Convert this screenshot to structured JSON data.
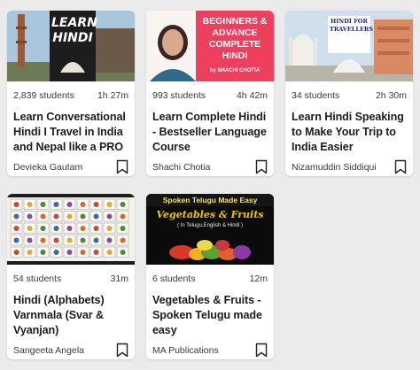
{
  "courses": [
    {
      "students": "2,839 students",
      "duration": "1h 27m",
      "title": "Learn Conversational Hindi I Travel in India and Nepal like a PRO",
      "instructor": "Devieka Gautam",
      "thumb_text": "LEARN HINDI"
    },
    {
      "students": "993 students",
      "duration": "4h 42m",
      "title": "Learn Complete Hindi - Bestseller Language Course",
      "instructor": "Shachi Chotia",
      "thumb_text": "BEGINNERS & ADVANCE COMPLETE HINDI",
      "thumb_sub": "by SHACHI CHOTIA"
    },
    {
      "students": "34 students",
      "duration": "2h 30m",
      "title": "Learn Hindi Speaking to Make Your Trip to India Easier",
      "instructor": "Nizamuddin Siddiqui",
      "thumb_text": "HINDI FOR TRAVELLERS"
    },
    {
      "students": "54 students",
      "duration": "31m",
      "title": "Hindi (Alphabets) Varnmala (Svar & Vyanjan)",
      "instructor": "Sangeeta Angela"
    },
    {
      "students": "6 students",
      "duration": "12m",
      "title": "Vegetables & Fruits - Spoken Telugu made easy",
      "instructor": "MA Publications",
      "thumb_text": "Spoken Telugu Made Easy",
      "thumb_title": "Vegetables & Fruits",
      "thumb_sub": "( In Telugu,English & Hindi )"
    }
  ]
}
